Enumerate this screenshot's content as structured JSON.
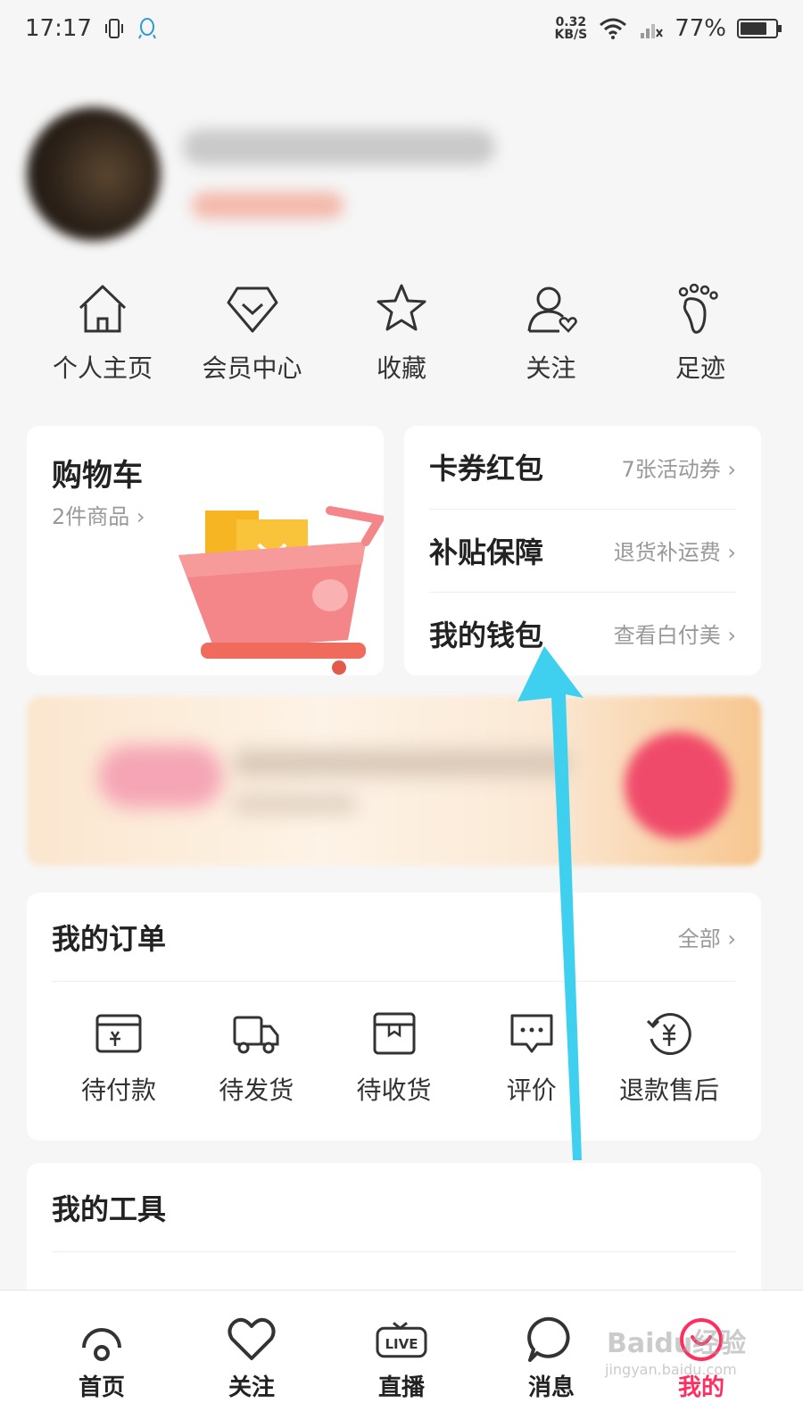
{
  "status": {
    "time": "17:17",
    "net_speed": "0.32",
    "net_unit": "KB/S",
    "battery": "77%",
    "battery_level": 0.77
  },
  "quick": [
    {
      "icon": "home-icon",
      "label": "个人主页"
    },
    {
      "icon": "diamond-icon",
      "label": "会员中心"
    },
    {
      "icon": "star-icon",
      "label": "收藏"
    },
    {
      "icon": "follow-user-icon",
      "label": "关注"
    },
    {
      "icon": "footprint-icon",
      "label": "足迹"
    }
  ],
  "cart": {
    "title": "购物车",
    "subtitle": "2件商品",
    "chevron": "›"
  },
  "benefits": [
    {
      "title": "卡券红包",
      "meta": "7张活动券"
    },
    {
      "title": "补贴保障",
      "meta": "退货补运费"
    },
    {
      "title": "我的钱包",
      "meta": "查看白付美"
    }
  ],
  "orders": {
    "title": "我的订单",
    "more": "全部",
    "items": [
      {
        "icon": "pending-payment-icon",
        "label": "待付款"
      },
      {
        "icon": "pending-shipment-icon",
        "label": "待发货"
      },
      {
        "icon": "pending-receipt-icon",
        "label": "待收货"
      },
      {
        "icon": "review-icon",
        "label": "评价"
      },
      {
        "icon": "refund-icon",
        "label": "退款售后"
      }
    ]
  },
  "tools": {
    "title": "我的工具"
  },
  "tabs": [
    {
      "icon": "home-tab-icon",
      "label": "首页",
      "active": false
    },
    {
      "icon": "heart-icon",
      "label": "关注",
      "active": false
    },
    {
      "icon": "live-tv-icon",
      "label": "直播",
      "active": false
    },
    {
      "icon": "message-icon",
      "label": "消息",
      "active": false
    },
    {
      "icon": "mine-icon",
      "label": "我的",
      "active": true
    }
  ],
  "colors": {
    "accent": "#ff2e5e",
    "arrow": "#3fd0f0"
  },
  "watermark": {
    "main": "Baidu经验",
    "sub": "jingyan.baidu.com"
  }
}
